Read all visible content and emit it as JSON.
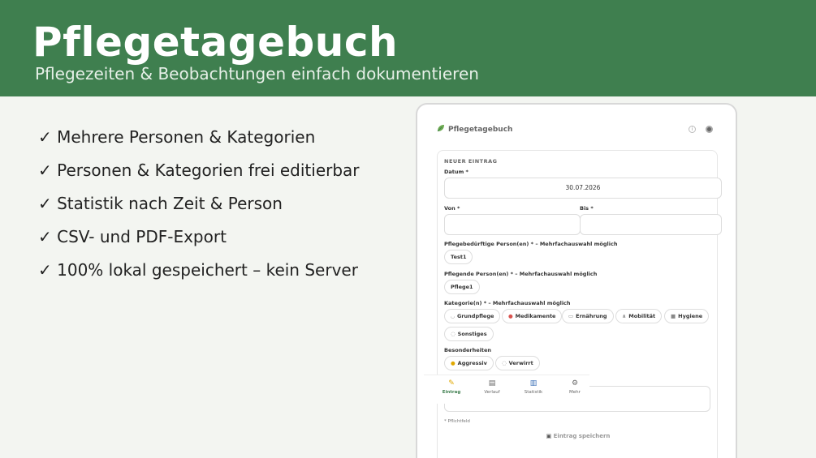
{
  "banner": {
    "title": "Pflegetagebuch",
    "subtitle": "Pflegezeiten & Beobachtungen einfach dokumentieren"
  },
  "features": [
    "✓ Mehrere Personen & Kategorien",
    "✓ Personen & Kategorien frei editierbar",
    "✓ Statistik nach Zeit & Person",
    "✓ CSV- und PDF-Export",
    "✓ 100% lokal gespeichert – kein Server"
  ],
  "app": {
    "title": "Pflegetagebuch",
    "info_glyph": "i",
    "card_title": "NEUER EINTRAG",
    "date_label": "Datum *",
    "date_value": "30.07.2026",
    "from_label": "Von *",
    "to_label": "Bis *",
    "patients_label": "Pflegebedürftige Person(en) * – Mehrfachauswahl möglich",
    "patient_chip": "Test1",
    "carers_label": "Pflegende Person(en) * – Mehrfachauswahl möglich",
    "carer_chip": "Pflege1",
    "categories_label": "Kategorie(n) * – Mehrfachauswahl möglich",
    "categories": [
      "Grundpflege",
      "Medikamente",
      "Ernährung",
      "Mobilität",
      "Hygiene",
      "Sonstiges"
    ],
    "special_label": "Besonderheiten",
    "specials": [
      "Aggressiv",
      "Verwirrt"
    ],
    "required_note": "* Pflichtfeld",
    "save_label": "Eintrag speichern",
    "tabs": [
      "Eintrag",
      "Verlauf",
      "Statistik",
      "Mehr"
    ],
    "accent_color": "#3f7f4f",
    "icons": {
      "tabs": [
        "pencil-icon",
        "list-icon",
        "chart-icon",
        "gear-icon"
      ],
      "categories": [
        "basin-icon",
        "pill-icon",
        "plate-icon",
        "walker-icon",
        "soap-icon",
        "speech-bubble-icon"
      ],
      "specials": [
        "angry-face-icon",
        "thought-bubble-icon"
      ]
    }
  }
}
